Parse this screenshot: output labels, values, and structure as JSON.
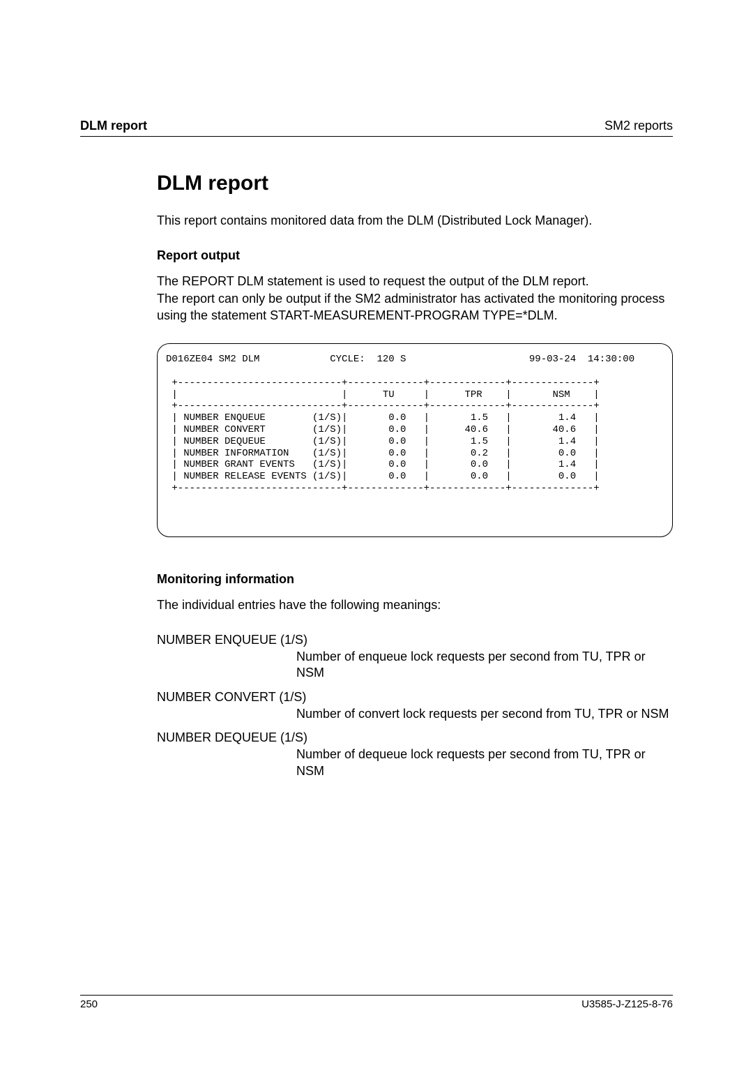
{
  "header": {
    "left": "DLM report",
    "right": "SM2 reports"
  },
  "title": "DLM report",
  "intro": "This report contains monitored data from the DLM (Distributed Lock Manager).",
  "section_output": {
    "heading": "Report output",
    "body": "The REPORT DLM statement is used to request the output of the DLM report.\nThe report can only be output if the SM2 administrator has activated the monitoring process using the statement START-MEASUREMENT-PROGRAM TYPE=*DLM."
  },
  "chart_data": {
    "type": "table",
    "title_line": "D016ZE04 SM2 DLM            CYCLE:  120 S                     99-03-24  14:30:00",
    "columns": [
      "",
      "TU",
      "TPR",
      "NSM"
    ],
    "rows": [
      {
        "label": "NUMBER ENQUEUE        (1/S)",
        "TU": "0.0",
        "TPR": "1.5",
        "NSM": "1.4"
      },
      {
        "label": "NUMBER CONVERT        (1/S)",
        "TU": "0.0",
        "TPR": "40.6",
        "NSM": "40.6"
      },
      {
        "label": "NUMBER DEQUEUE        (1/S)",
        "TU": "0.0",
        "TPR": "1.5",
        "NSM": "1.4"
      },
      {
        "label": "NUMBER INFORMATION    (1/S)",
        "TU": "0.0",
        "TPR": "0.2",
        "NSM": "0.0"
      },
      {
        "label": "NUMBER GRANT EVENTS   (1/S)",
        "TU": "0.0",
        "TPR": "0.0",
        "NSM": "1.4"
      },
      {
        "label": "NUMBER RELEASE EVENTS (1/S)",
        "TU": "0.0",
        "TPR": "0.0",
        "NSM": "0.0"
      }
    ]
  },
  "section_monitor": {
    "heading": "Monitoring information",
    "lead": "The individual entries have the following meanings:",
    "defs": [
      {
        "term": "NUMBER ENQUEUE (1/S)",
        "body": "Number of enqueue lock requests per second from TU, TPR or NSM"
      },
      {
        "term": "NUMBER CONVERT (1/S)",
        "body": "Number of convert lock requests per second from TU, TPR or NSM"
      },
      {
        "term": "NUMBER DEQUEUE (1/S)",
        "body": "Number of dequeue lock requests per second from TU, TPR or NSM"
      }
    ]
  },
  "footer": {
    "page": "250",
    "doc": "U3585-J-Z125-8-76"
  }
}
